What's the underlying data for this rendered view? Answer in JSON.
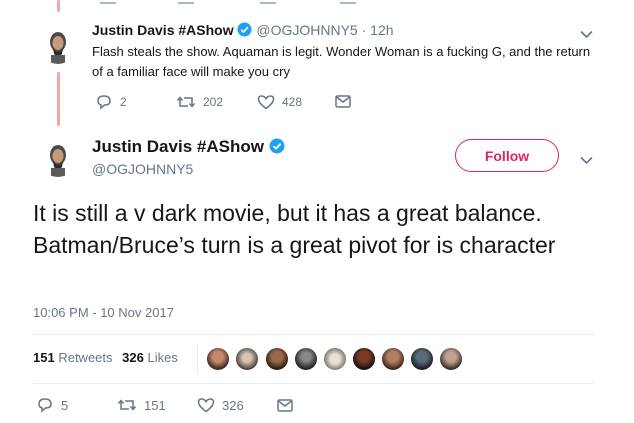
{
  "reply_tweet": {
    "display_name": "Justin Davis #AShow",
    "handle": "@OGJOHNNY5",
    "separator": "·",
    "time": "12h",
    "text": "Flash steals the show. Aquaman is legit. Wonder Woman is a fucking G, and the return of a familiar face will make you cry",
    "replies": "2",
    "retweets": "202",
    "likes": "428"
  },
  "main_tweet": {
    "display_name": "Justin Davis #AShow",
    "handle": "@OGJOHNNY5",
    "follow_label": "Follow",
    "text": "It is still a v dark movie, but it has a great balance. Batman/Bruce’s turn is a great pivot for is character",
    "timestamp": "10:06 PM - 10 Nov 2017",
    "stats": {
      "retweets_count": "151",
      "retweets_label": "Retweets",
      "likes_count": "326",
      "likes_label": "Likes"
    },
    "actions": {
      "replies": "5",
      "retweets": "151",
      "likes": "326"
    }
  },
  "colors": {
    "accent": "#e0245e",
    "verified": "#1da1f2",
    "muted_text": "#657786",
    "thread_line": "#f2a8a8"
  },
  "icons": [
    "verified-badge-icon",
    "chevron-down-icon",
    "reply-icon",
    "retweet-icon",
    "like-icon",
    "direct-message-icon"
  ]
}
